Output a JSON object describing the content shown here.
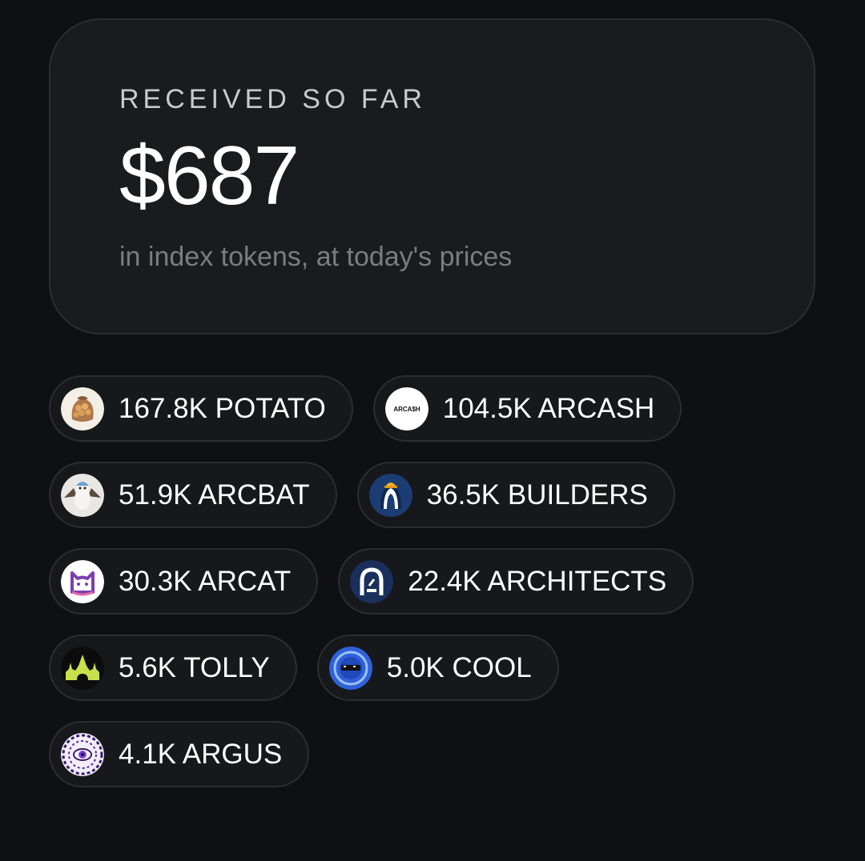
{
  "summary": {
    "label": "RECEIVED SO FAR",
    "amount": "$687",
    "note": "in index tokens, at today's prices"
  },
  "tokens": [
    {
      "text": "167.8K POTATO",
      "icon": "potato-icon"
    },
    {
      "text": "104.5K ARCASH",
      "icon": "arcash-icon",
      "icon_text": "ARCA$H"
    },
    {
      "text": "51.9K ARCBAT",
      "icon": "arcbat-icon"
    },
    {
      "text": "36.5K BUILDERS",
      "icon": "builders-icon"
    },
    {
      "text": "30.3K ARCAT",
      "icon": "arcat-icon"
    },
    {
      "text": "22.4K ARCHITECTS",
      "icon": "architects-icon"
    },
    {
      "text": "5.6K TOLLY",
      "icon": "tolly-icon"
    },
    {
      "text": "5.0K COOL",
      "icon": "cool-icon"
    },
    {
      "text": "4.1K ARGUS",
      "icon": "argus-icon"
    }
  ],
  "colors": {
    "background": "#0f1013",
    "card": "#1a1b1e",
    "border": "#2c2d31",
    "muted_text": "#7b7c80"
  }
}
